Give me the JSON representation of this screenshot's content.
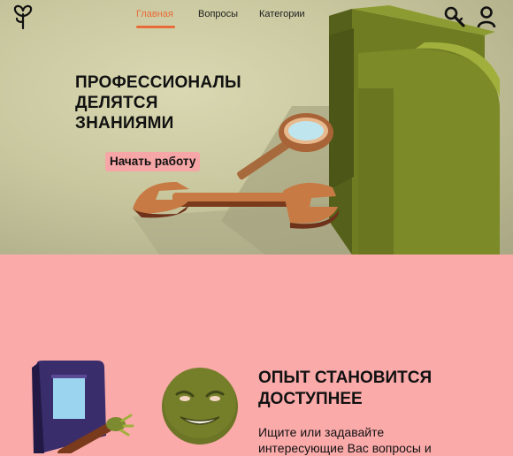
{
  "nav": {
    "links": [
      {
        "label": "Главная",
        "active": true
      },
      {
        "label": "Вопросы",
        "active": false
      },
      {
        "label": "Категории",
        "active": false
      }
    ],
    "icons": [
      "search-icon",
      "user-icon"
    ],
    "logo": "tree-logo"
  },
  "hero": {
    "title_lines": [
      "ПРОФЕССИОНАЛЫ",
      "ДЕЛЯТСЯ",
      "ЗНАНИЯМИ"
    ],
    "cta_label": "Начать работу"
  },
  "section": {
    "title_lines": [
      "ОПЫТ СТАНОВИТСЯ",
      "ДОСТУПНЕЕ"
    ],
    "text_lines": [
      "Ищите или задавайте",
      "интересующие Вас вопросы и"
    ]
  },
  "colors": {
    "accent": "#e86c3a",
    "hero_bg": "#c9c79e",
    "section_bg": "#fbaaaa",
    "cta_bg": "#f6a6a6",
    "olive": "#8a9a2e"
  }
}
